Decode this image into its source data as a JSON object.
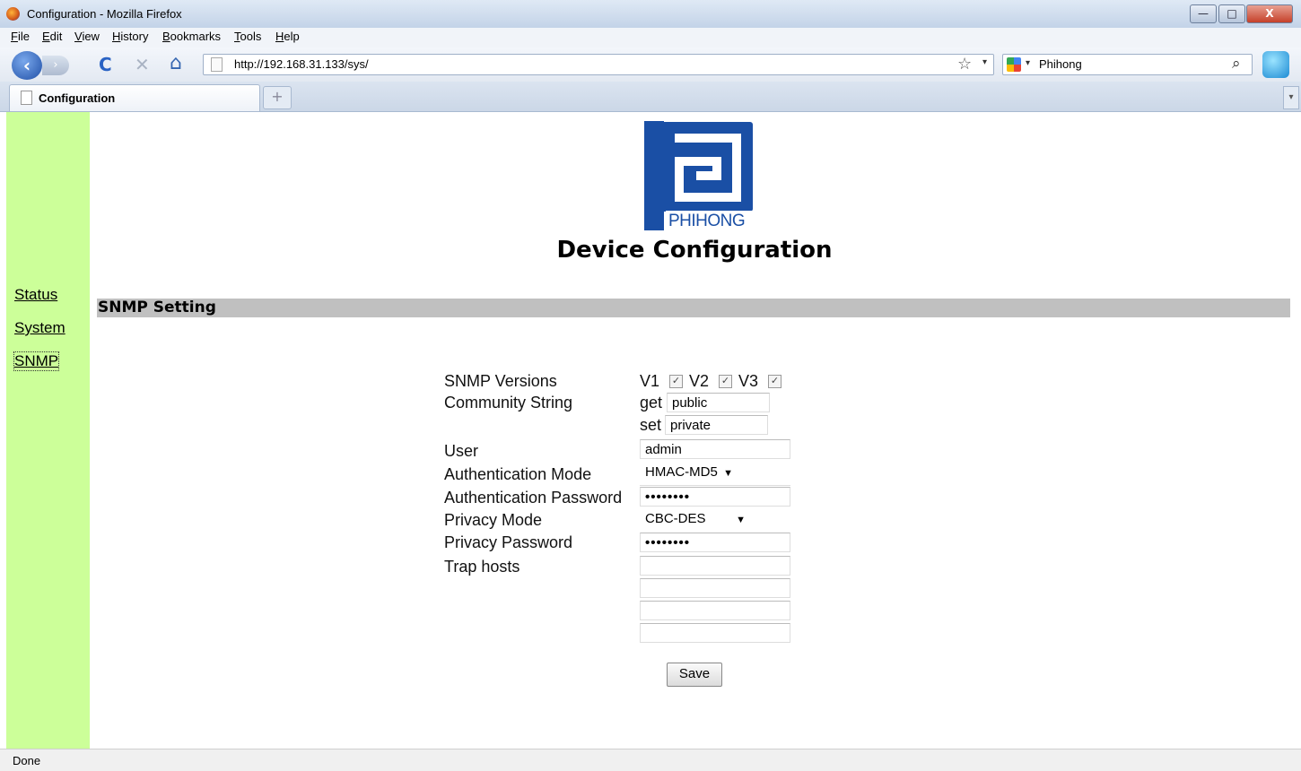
{
  "window": {
    "title": "Configuration - Mozilla Firefox",
    "min_label": "—",
    "max_label": "□",
    "close_label": "X"
  },
  "menu": [
    "File",
    "Edit",
    "View",
    "History",
    "Bookmarks",
    "Tools",
    "Help"
  ],
  "nav": {
    "back_glyph": "‹",
    "forward_glyph": "›",
    "reload_glyph": "C",
    "stop_glyph": "✕",
    "home_glyph": "⌂",
    "url": "http://192.168.31.133/sys/",
    "star_glyph": "☆",
    "search_engine_label": "Phihong",
    "search_glyph": "⌕"
  },
  "tabs": [
    {
      "label": "Configuration"
    }
  ],
  "newtab_glyph": "+",
  "logo_text": "PHIHONG",
  "page_title": "Device Configuration",
  "sidebar": {
    "items": [
      "Status",
      "System",
      "SNMP"
    ]
  },
  "section_title": "SNMP Setting",
  "form": {
    "snmp_versions_label": "SNMP Versions",
    "versions": [
      {
        "label": "V1",
        "checked": true
      },
      {
        "label": "V2",
        "checked": true
      },
      {
        "label": "V3",
        "checked": true
      }
    ],
    "community_label": "Community String",
    "get_label": "get",
    "get_value": "public",
    "set_label": "set",
    "set_value": "private",
    "user_label": "User",
    "user_value": "admin",
    "auth_mode_label": "Authentication Mode",
    "auth_mode_value": "HMAC-MD5",
    "auth_password_label": "Authentication Password",
    "auth_password_value": "••••••••",
    "privacy_mode_label": "Privacy Mode",
    "privacy_mode_value": "CBC-DES",
    "privacy_password_label": "Privacy Password",
    "privacy_password_value": "••••••••",
    "trap_hosts_label": "Trap hosts",
    "trap_hosts": [
      "",
      "",
      "",
      ""
    ],
    "save_label": "Save"
  },
  "status_text": "Done",
  "colors": {
    "sidebar": "#ccff99",
    "logo": "#1a4fa5",
    "section_bar": "#c0c0c0"
  }
}
